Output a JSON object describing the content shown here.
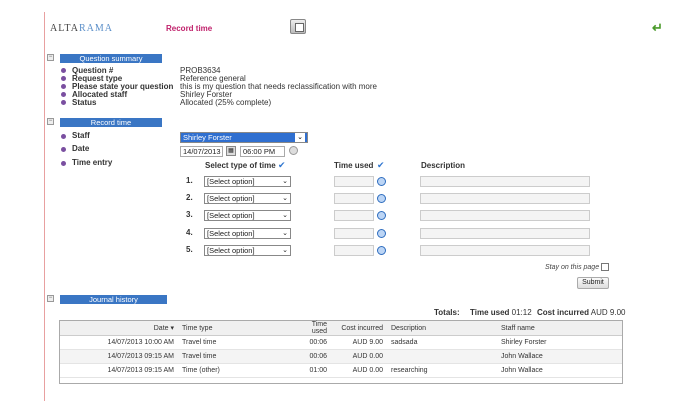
{
  "header": {
    "logo_alta": "ALTA",
    "logo_rama": "RAMA",
    "page_title": "Record time"
  },
  "question_summary": {
    "title": "Question summary",
    "fields": [
      {
        "label": "Question #",
        "value": "PROB3634"
      },
      {
        "label": "Request type",
        "value": "Reference general"
      },
      {
        "label": "Please state your question",
        "value": "this is my question that needs reclassification with more"
      },
      {
        "label": "Allocated staff",
        "value": "Shirley Forster"
      },
      {
        "label": "Status",
        "value": "Allocated (25% complete)"
      }
    ]
  },
  "record_time": {
    "title": "Record time",
    "staff_label": "Staff",
    "staff_value": "Shirley Forster",
    "date_label": "Date",
    "date_value": "14/07/2013",
    "time_value": "06:00 PM",
    "time_entry_label": "Time entry",
    "col_type": "Select type of time",
    "col_used": "Time used",
    "col_desc": "Description",
    "rows": [
      {
        "num": "1.",
        "type": "[Select option]"
      },
      {
        "num": "2.",
        "type": "[Select option]"
      },
      {
        "num": "3.",
        "type": "[Select option]"
      },
      {
        "num": "4.",
        "type": "[Select option]"
      },
      {
        "num": "5.",
        "type": "[Select option]"
      }
    ],
    "stay_label": "Stay on this page",
    "submit_label": "Submit"
  },
  "journal": {
    "title": "Journal history",
    "totals_label": "Totals:",
    "time_used_label": "Time used",
    "time_used_value": "01:12",
    "cost_label": "Cost incurred",
    "cost_value": "AUD 9.00",
    "columns": [
      "Date ▾",
      "Time type",
      "Time used",
      "Cost incurred",
      "Description",
      "Staff name"
    ],
    "rows": [
      [
        "14/07/2013 10:00 AM",
        "Travel time",
        "00:06",
        "AUD 9.00",
        "sadsada",
        "Shirley Forster"
      ],
      [
        "14/07/2013 09:15 AM",
        "Travel time",
        "00:06",
        "AUD 0.00",
        "",
        "John Wallace"
      ],
      [
        "14/07/2013 09:15 AM",
        "Time (other)",
        "01:00",
        "AUD 0.00",
        "researching",
        "John Wallace"
      ]
    ]
  }
}
